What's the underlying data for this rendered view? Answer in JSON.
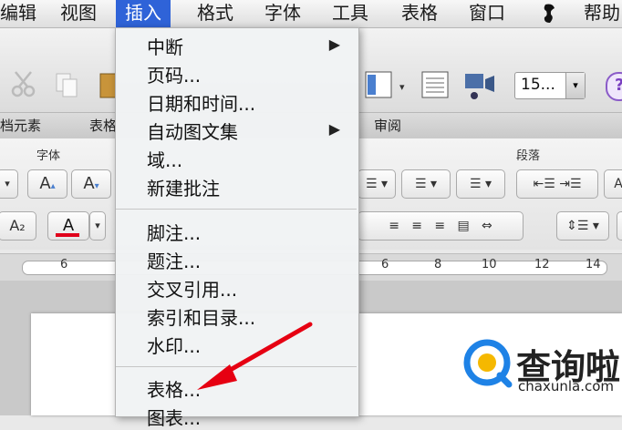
{
  "menubar": {
    "items": [
      "编辑",
      "视图",
      "插入",
      "格式",
      "字体",
      "工具",
      "表格",
      "窗口",
      "帮助"
    ],
    "script_icon": "script-icon"
  },
  "toolbar": {
    "zoom_value": "15...",
    "icons": [
      "cut-icon",
      "copy-icon",
      "paste-icon",
      "sidebar-icon",
      "columns-icon",
      "media-icon",
      "help-icon"
    ]
  },
  "tabs": [
    "档元素",
    "表格",
    "审阅"
  ],
  "ribbon": {
    "group_font": "字体",
    "group_paragraph": "段落",
    "font_buttons": [
      "A",
      "A",
      "A₂",
      "A"
    ],
    "colors": {
      "font_red": "#e0001b",
      "accent_blue": "#2f63d8"
    }
  },
  "ruler": {
    "ticks": [
      "6",
      "6",
      "8",
      "10",
      "12",
      "14"
    ]
  },
  "insert_menu": {
    "items_group1": [
      "中断",
      "页码...",
      "日期和时间...",
      "自动图文集",
      "域...",
      "新建批注"
    ],
    "items_group2": [
      "脚注...",
      "题注...",
      "交叉引用...",
      "索引和目录...",
      "水印..."
    ],
    "items_group3": [
      "表格...",
      "图表..."
    ]
  },
  "watermark": {
    "name": "查询啦",
    "url": "chaxunla.com"
  }
}
